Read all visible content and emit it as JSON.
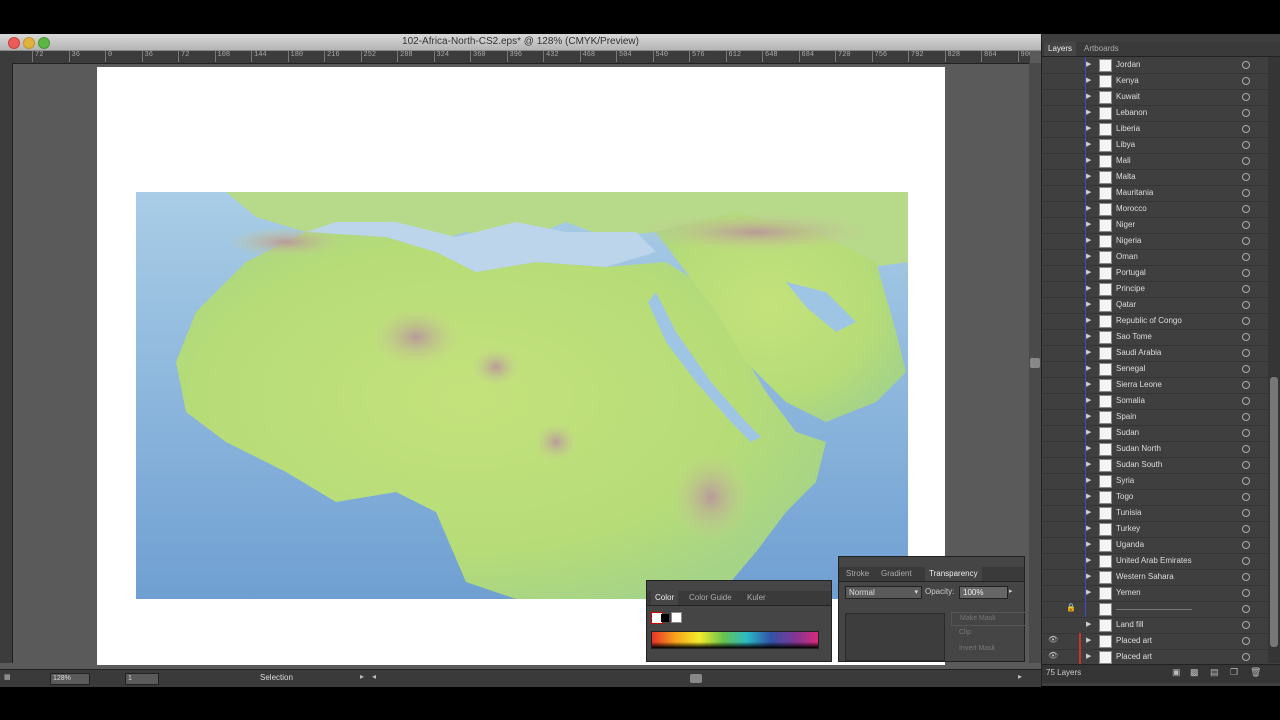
{
  "document": {
    "title": "102-Africa-North-CS2.eps* @ 128% (CMYK/Preview)",
    "ruler_ticks": [
      "72",
      "36",
      "0",
      "36",
      "72",
      "108",
      "144",
      "180",
      "216",
      "252",
      "288",
      "324",
      "360",
      "396",
      "432",
      "468",
      "504",
      "540",
      "576",
      "612",
      "648",
      "684",
      "720",
      "756",
      "792",
      "828",
      "864",
      "900",
      "936"
    ],
    "zoom": "128%",
    "page": "1",
    "tool": "Selection"
  },
  "color_panel": {
    "tabs": [
      "Color",
      "Color Guide",
      "Kuler"
    ]
  },
  "transparency_panel": {
    "tabs": [
      "Stroke",
      "Gradient",
      "Transparency"
    ],
    "blend_mode": "Normal",
    "opacity_label": "Opacity:",
    "opacity_value": "100%",
    "options": [
      "Make Mask",
      "Clip",
      "Invert Mask"
    ]
  },
  "layers_panel": {
    "tabs": [
      "Layers",
      "Artboards"
    ],
    "count": "75 Layers",
    "rows": [
      {
        "name": "Jordan"
      },
      {
        "name": "Kenya"
      },
      {
        "name": "Kuwait"
      },
      {
        "name": "Lebanon"
      },
      {
        "name": "Liberia"
      },
      {
        "name": "Libya"
      },
      {
        "name": "Mali"
      },
      {
        "name": "Malta"
      },
      {
        "name": "Mauritania"
      },
      {
        "name": "Morocco"
      },
      {
        "name": "Niger"
      },
      {
        "name": "Nigeria"
      },
      {
        "name": "Oman"
      },
      {
        "name": "Portugal"
      },
      {
        "name": "Principe"
      },
      {
        "name": "Qatar"
      },
      {
        "name": "Republic of Congo"
      },
      {
        "name": "Sao Tome"
      },
      {
        "name": "Saudi Arabia"
      },
      {
        "name": "Senegal"
      },
      {
        "name": "Sierra Leone"
      },
      {
        "name": "Somalia"
      },
      {
        "name": "Spain"
      },
      {
        "name": "Sudan"
      },
      {
        "name": "Sudan North"
      },
      {
        "name": "Sudan South"
      },
      {
        "name": "Syria"
      },
      {
        "name": "Togo"
      },
      {
        "name": "Tunisia"
      },
      {
        "name": "Turkey"
      },
      {
        "name": "Uganda"
      },
      {
        "name": "United Arab Emirates"
      },
      {
        "name": "Western Sahara"
      },
      {
        "name": "Yemen"
      },
      {
        "name": ""
      },
      {
        "name": "Land fill"
      },
      {
        "name": "Placed art"
      },
      {
        "name": "Placed art"
      }
    ]
  }
}
